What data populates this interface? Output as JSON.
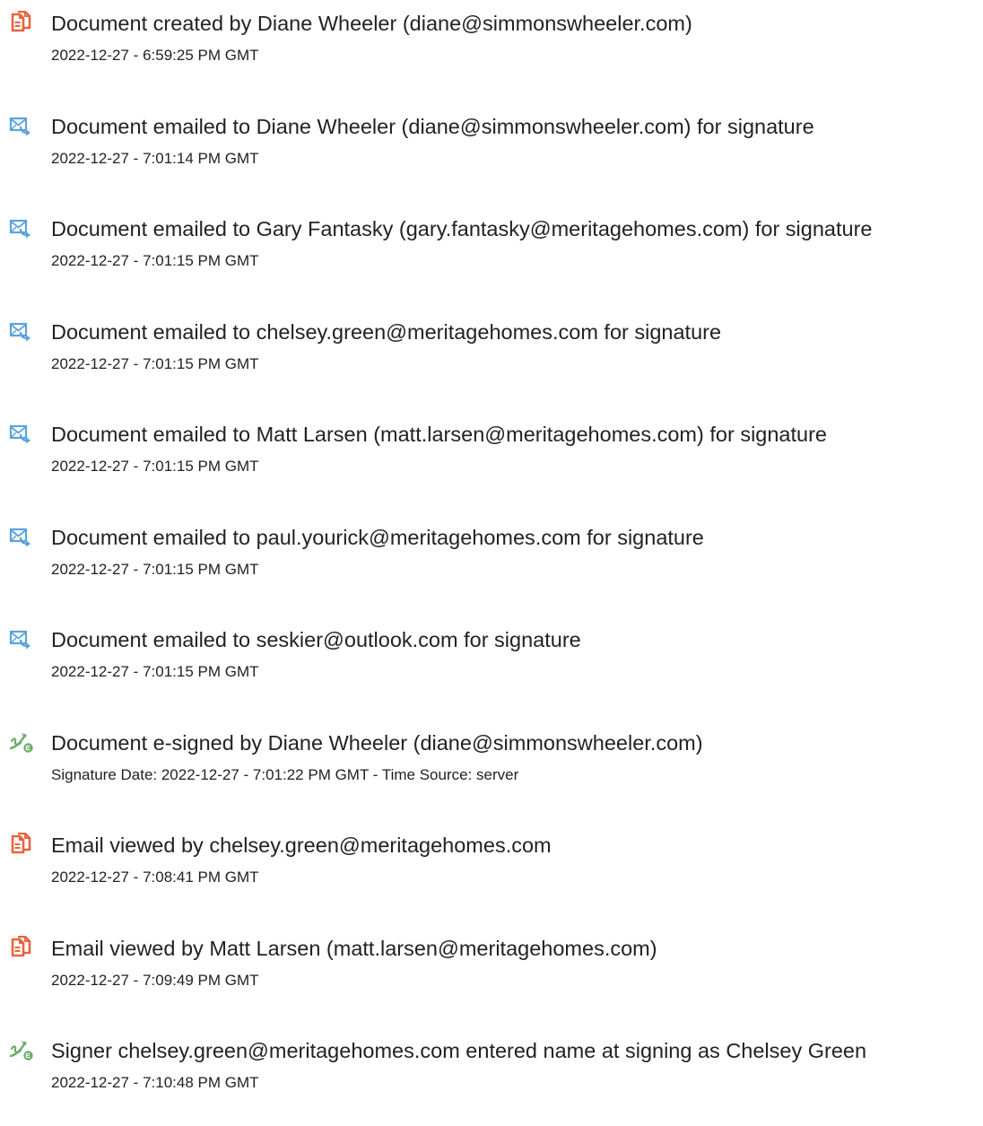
{
  "colors": {
    "doc_icon": "#e8643f",
    "email_icon": "#5aa3dc",
    "sign_icon": "#6cab6a"
  },
  "entries": [
    {
      "icon": "document-icon",
      "title": "Document created by Diane Wheeler (diane@simmonswheeler.com)",
      "detail": "2022-12-27 - 6:59:25 PM GMT"
    },
    {
      "icon": "email-icon",
      "title": "Document emailed to Diane Wheeler (diane@simmonswheeler.com) for signature",
      "detail": "2022-12-27 - 7:01:14 PM GMT"
    },
    {
      "icon": "email-icon",
      "title": "Document emailed to Gary Fantasky (gary.fantasky@meritagehomes.com) for signature",
      "detail": "2022-12-27 - 7:01:15 PM GMT"
    },
    {
      "icon": "email-icon",
      "title": "Document emailed to chelsey.green@meritagehomes.com for signature",
      "detail": "2022-12-27 - 7:01:15 PM GMT"
    },
    {
      "icon": "email-icon",
      "title": "Document emailed to Matt Larsen (matt.larsen@meritagehomes.com) for signature",
      "detail": "2022-12-27 - 7:01:15 PM GMT"
    },
    {
      "icon": "email-icon",
      "title": "Document emailed to paul.yourick@meritagehomes.com for signature",
      "detail": "2022-12-27 - 7:01:15 PM GMT"
    },
    {
      "icon": "email-icon",
      "title": "Document emailed to seskier@outlook.com for signature",
      "detail": "2022-12-27 - 7:01:15 PM GMT"
    },
    {
      "icon": "esign-icon",
      "title": "Document e-signed by Diane Wheeler (diane@simmonswheeler.com)",
      "detail": "Signature Date: 2022-12-27 - 7:01:22 PM GMT - Time Source: server"
    },
    {
      "icon": "document-icon",
      "title": "Email viewed by chelsey.green@meritagehomes.com",
      "detail": "2022-12-27 - 7:08:41 PM GMT"
    },
    {
      "icon": "document-icon",
      "title": "Email viewed by Matt Larsen (matt.larsen@meritagehomes.com)",
      "detail": "2022-12-27 - 7:09:49 PM GMT"
    },
    {
      "icon": "esign-icon",
      "title": "Signer chelsey.green@meritagehomes.com entered name at signing as Chelsey Green",
      "detail": "2022-12-27 - 7:10:48 PM GMT"
    }
  ]
}
